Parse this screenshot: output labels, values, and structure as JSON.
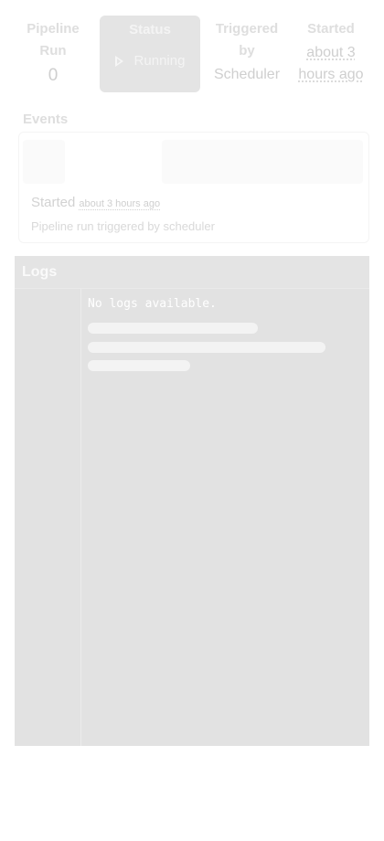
{
  "summary": {
    "pipeline_run": {
      "title": "Pipeline Run",
      "value": "0"
    },
    "status": {
      "title": "Status",
      "value": "Running",
      "icon": "play-icon"
    },
    "triggered_by": {
      "title": "Triggered by",
      "value": "Scheduler"
    },
    "started": {
      "title": "Started",
      "value": "about 3 hours ago"
    }
  },
  "events": {
    "title": "Events",
    "items": [
      {
        "label": "Started",
        "time": "about 3 hours ago",
        "description": "Pipeline run triggered by scheduler"
      }
    ]
  },
  "logs": {
    "title": "Logs",
    "empty_message": "No logs available."
  },
  "colors": {
    "status_bg": "#e4e4e4",
    "logs_bg": "#e2e2e2"
  }
}
